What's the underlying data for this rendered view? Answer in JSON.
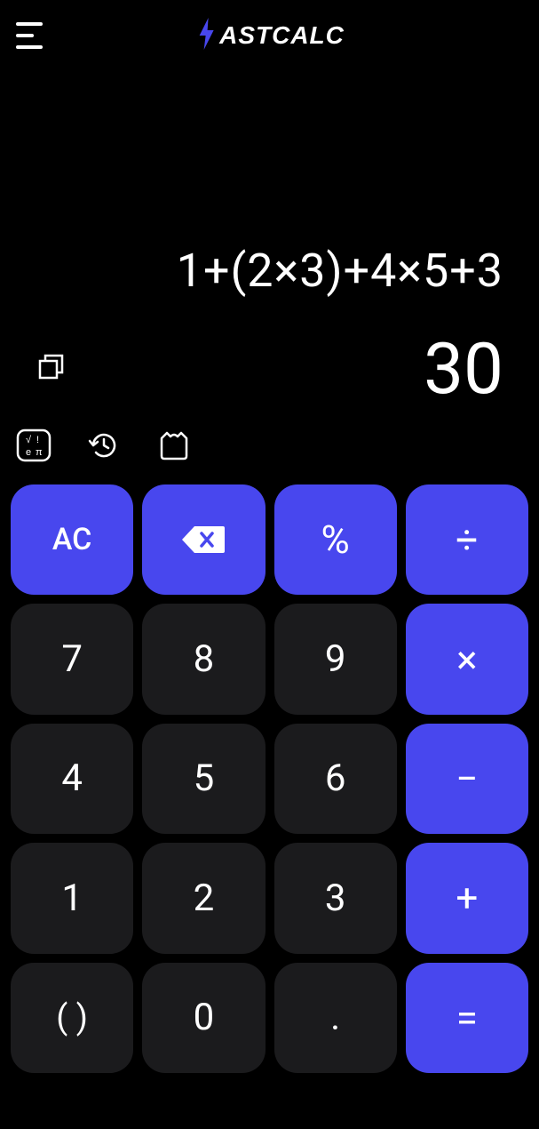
{
  "app": {
    "name": "ASTCALC"
  },
  "display": {
    "expression": "1+(2×3)+4×5+3",
    "result": "30"
  },
  "keys": {
    "ac": "AC",
    "percent": "%",
    "divide": "÷",
    "seven": "7",
    "eight": "8",
    "nine": "9",
    "multiply": "×",
    "four": "4",
    "five": "5",
    "six": "6",
    "minus": "−",
    "one": "1",
    "two": "2",
    "three": "3",
    "plus": "+",
    "parens": "( )",
    "zero": "0",
    "dot": ".",
    "equals": "="
  }
}
